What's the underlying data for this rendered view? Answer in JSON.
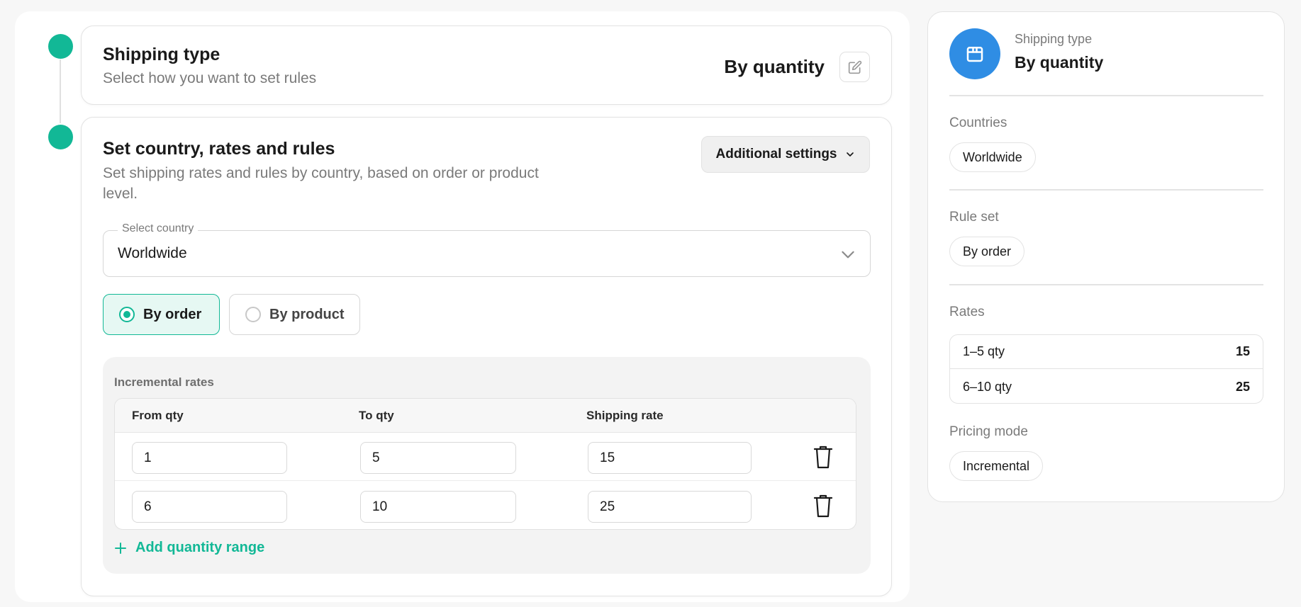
{
  "steps": {
    "shipping_type": {
      "title": "Shipping type",
      "subtitle": "Select how you want to set rules",
      "value": "By quantity"
    },
    "country_rates": {
      "title": "Set country, rates and rules",
      "subtitle_line1": "Set shipping rates and rules by country, based on order or product",
      "subtitle_line2": "level.",
      "additional_settings_label": "Additional settings",
      "country_select": {
        "label": "Select country",
        "value": "Worldwide"
      },
      "rule_options": [
        {
          "label": "By order",
          "selected": true
        },
        {
          "label": "By product",
          "selected": false
        }
      ],
      "rates": {
        "title": "Incremental rates",
        "columns": [
          "From qty",
          "To qty",
          "Shipping rate"
        ],
        "rows": [
          {
            "from": "1",
            "to": "5",
            "rate": "15"
          },
          {
            "from": "6",
            "to": "10",
            "rate": "25"
          }
        ],
        "add_label": "Add quantity range"
      }
    }
  },
  "summary": {
    "type_label": "Shipping type",
    "type_value": "By quantity",
    "countries_label": "Countries",
    "countries_value": "Worldwide",
    "rule_set_label": "Rule set",
    "rule_set_value": "By order",
    "rates_label": "Rates",
    "rates": [
      {
        "range": "1–5 qty",
        "value": "15"
      },
      {
        "range": "6–10 qty",
        "value": "25"
      }
    ],
    "pricing_mode_label": "Pricing mode",
    "pricing_mode_value": "Incremental"
  },
  "colors": {
    "accent": "#12b896",
    "summary_icon_bg": "#2f8de4"
  },
  "icons": [
    "edit-icon",
    "chevron-down-icon",
    "trash-icon",
    "plus-icon",
    "box-icon"
  ]
}
